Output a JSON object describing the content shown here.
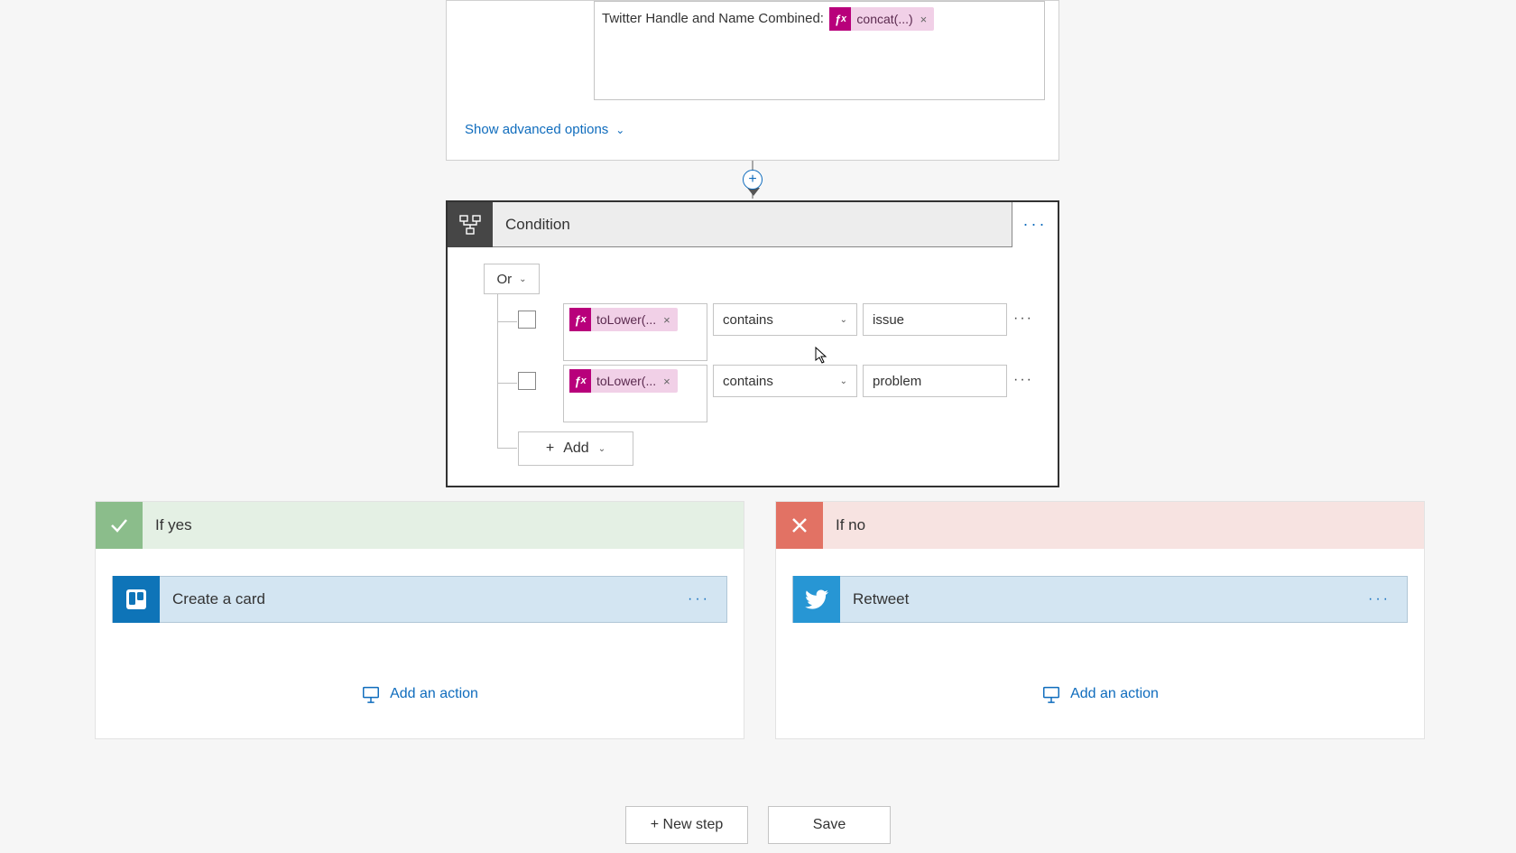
{
  "top_card": {
    "desc_label": "Twitter Handle and Name Combined:",
    "chip_label": "concat(...)",
    "advanced_link": "Show advanced options"
  },
  "condition": {
    "title": "Condition",
    "group_op": "Or",
    "rows": [
      {
        "expr": "toLower(...",
        "op": "contains",
        "value": "issue"
      },
      {
        "expr": "toLower(...",
        "op": "contains",
        "value": "problem"
      }
    ],
    "add_label": "Add"
  },
  "branches": {
    "yes": {
      "title": "If yes",
      "action": "Create a card",
      "add_action": "Add an action"
    },
    "no": {
      "title": "If no",
      "action": "Retweet",
      "add_action": "Add an action"
    }
  },
  "footer": {
    "new_step": "+ New step",
    "save": "Save"
  },
  "icons": {
    "fx": "fx",
    "chevron_down": "⌄"
  }
}
